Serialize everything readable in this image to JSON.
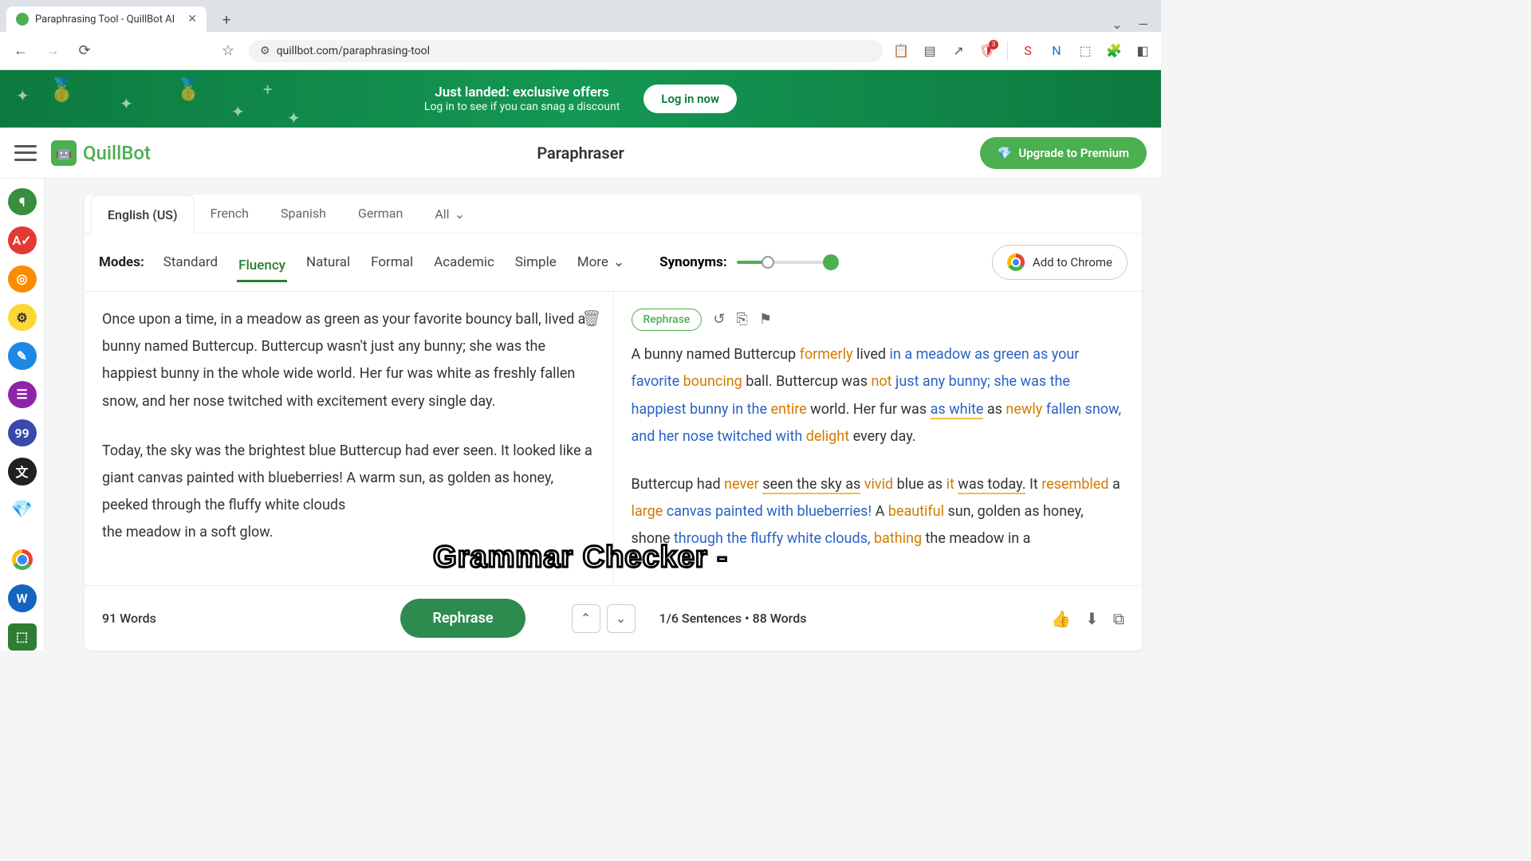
{
  "browser": {
    "tab_title": "Paraphrasing Tool - QuillBot AI",
    "url": "quillbot.com/paraphrasing-tool"
  },
  "banner": {
    "title": "Just landed: exclusive offers",
    "subtitle": "Log in to see if you can snag a discount",
    "cta": "Log in now"
  },
  "header": {
    "logo": "QuillBot",
    "page_title": "Paraphraser",
    "upgrade": "Upgrade to Premium"
  },
  "languages": {
    "items": [
      "English (US)",
      "French",
      "Spanish",
      "German"
    ],
    "all": "All"
  },
  "modes": {
    "label": "Modes:",
    "items": [
      "Standard",
      "Fluency",
      "Natural",
      "Formal",
      "Academic",
      "Simple"
    ],
    "more": "More",
    "active": "Fluency"
  },
  "synonyms": {
    "label": "Synonyms:"
  },
  "add_chrome": "Add to Chrome",
  "input": {
    "p1": "Once upon a time, in a meadow as green as your favorite bouncy ball, lived a bunny named Buttercup. Buttercup wasn't just any bunny; she was the happiest bunny in the whole wide world. Her fur was white as freshly fallen snow, and her nose twitched with excitement every single day.",
    "p2": "Today, the sky was the brightest blue Buttercup had ever seen. It looked like a giant canvas painted with blueberries! A warm sun, as golden as honey, peeked through the fluffy white clouds",
    "p3": "the meadow in a soft glow.",
    "word_count": "91 Words",
    "rephrase": "Rephrase"
  },
  "output": {
    "rephrase_pill": "Rephrase",
    "sentence_info": "1/6 Sentences  •  88 Words"
  },
  "caption": "Grammar Checker -"
}
